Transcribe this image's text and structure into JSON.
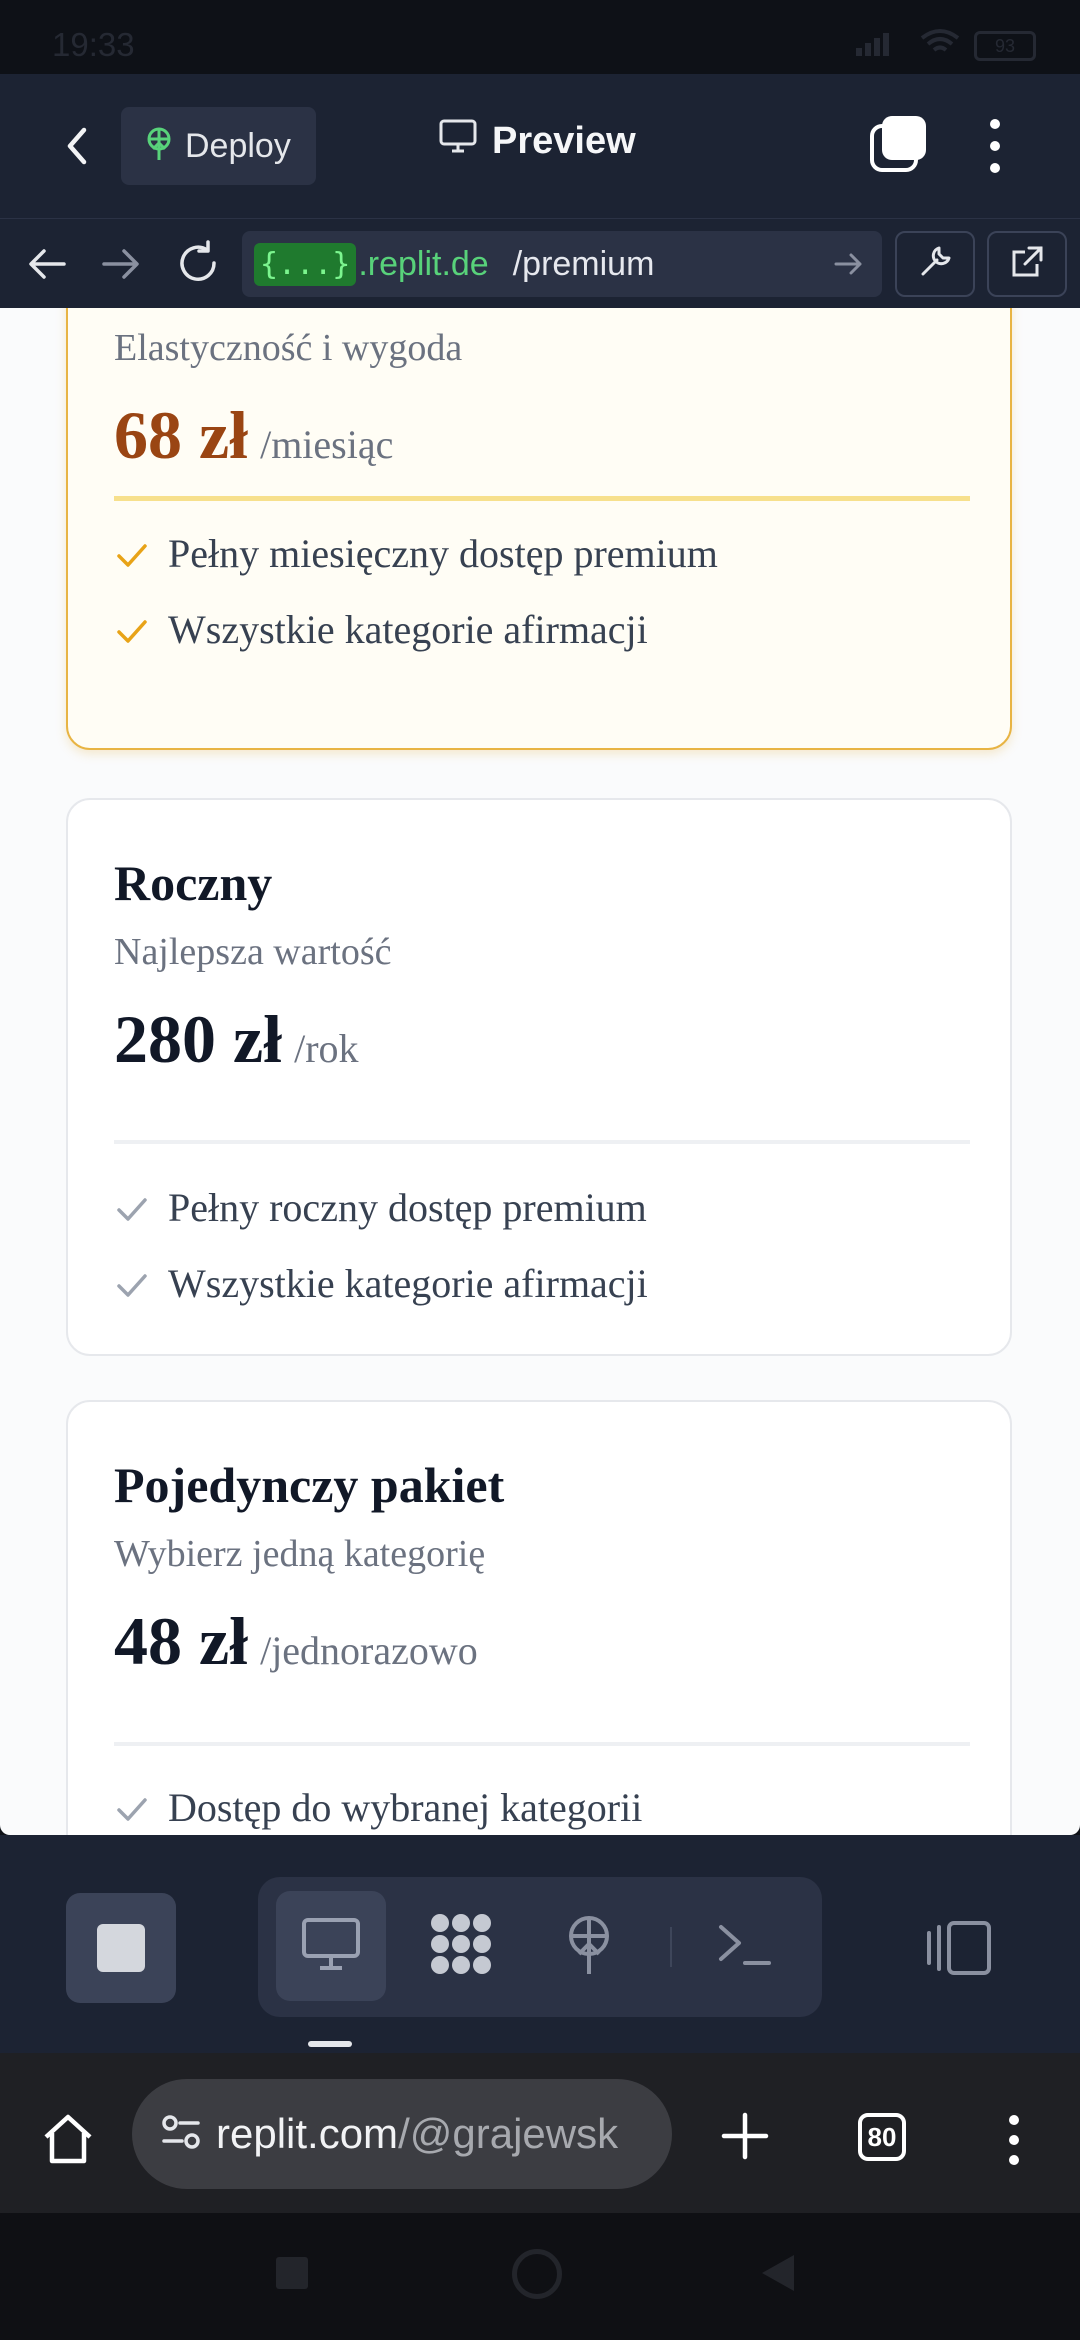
{
  "status_bar": {
    "time": "19:33",
    "battery": "93"
  },
  "topbar": {
    "deploy_label": "Deploy",
    "preview_label": "Preview"
  },
  "url_bar": {
    "host_badge": "{...}",
    "host": ".replit.de",
    "path": "/premium"
  },
  "plans": [
    {
      "subtitle": "Elastyczność i wygoda",
      "amount": "68 zł",
      "period": "/miesiąc",
      "features": [
        "Pełny miesięczny dostęp premium",
        "Wszystkie kategorie afirmacji"
      ]
    },
    {
      "title": "Roczny",
      "subtitle": "Najlepsza wartość",
      "amount": "280 zł",
      "period": "/rok",
      "features": [
        "Pełny roczny dostęp premium",
        "Wszystkie kategorie afirmacji"
      ]
    },
    {
      "title": "Pojedynczy pakiet",
      "subtitle": "Wybierz jedną kategorię",
      "amount": "48 zł",
      "period": "/jednorazowo",
      "features": [
        "Dostęp do wybranej kategorii"
      ]
    }
  ],
  "chrome": {
    "domain": "replit.com",
    "path": "/@grajewsk",
    "tab_count": "80"
  },
  "colors": {
    "accent_gold": "#e8b443",
    "price_brown": "#9a4513",
    "check_gold": "#e8a317",
    "check_gray": "#9ca3af",
    "replit_dark": "#1c2333"
  }
}
